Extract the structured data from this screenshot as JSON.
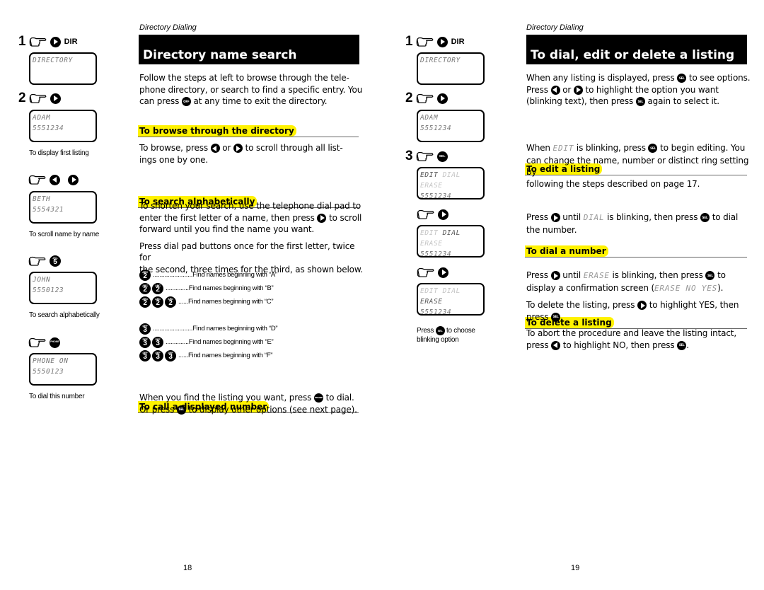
{
  "left_page": {
    "header_label": "Directory Dialing",
    "title": "Directory name search",
    "intro": [
      "Follow the steps at left to browse through the tele-",
      "phone directory, or search to find a specific entry. You",
      "can press",
      "at any time to exit the directory."
    ],
    "off_key_label": "OFF",
    "sections": {
      "browse": {
        "heading": "To browse through the directory",
        "text_before": "To browse, press",
        "or": "or",
        "text_after": "to scroll through all list-",
        "text_line2": "ings one by one."
      },
      "search": {
        "heading": "To search alphabetically",
        "p1_line1": "To shorten your search, use the telephone dial pad to",
        "p1_line2a": "enter the first letter of a name, then press",
        "p1_line2b": "to scroll",
        "p1_line3": "forward until you find the name you want.",
        "p2_line1": "Press dial pad buttons once for the first letter, twice for",
        "p2_line2": "the second, three times for the third, as shown below.",
        "find_rows": [
          {
            "key": "2",
            "key_letters": "ABC",
            "presses": 1,
            "dots": "........................",
            "text": "Find names beginning with “A”"
          },
          {
            "key": "2",
            "key_letters": "ABC",
            "presses": 2,
            "dots": "..............",
            "text": "Find names beginning with “B”"
          },
          {
            "key": "2",
            "key_letters": "ABC",
            "presses": 3,
            "dots": "......",
            "text": "Find names beginning with “C”"
          },
          {
            "key": "3",
            "key_letters": "DEF",
            "presses": 1,
            "dots": "........................",
            "text": "Find names beginning with “D”"
          },
          {
            "key": "3",
            "key_letters": "DEF",
            "presses": 2,
            "dots": "..............",
            "text": "Find names beginning with “E”"
          },
          {
            "key": "3",
            "key_letters": "DEF",
            "presses": 3,
            "dots": "......",
            "text": "Find names beginning with “F”"
          }
        ]
      },
      "call": {
        "heading": "To call a displayed number",
        "line1a": "When you find the listing you want, press",
        "line1b": "to dial.",
        "line2a": "Or press",
        "line2b": "to display other options (see next page).",
        "phone_key_label": "PHONE",
        "sel_key_label": "SEL"
      }
    },
    "steps": [
      {
        "num": "1",
        "button": "right-arrow",
        "button_label": "DIR",
        "lcd": [
          "DIRECTORY",
          ""
        ],
        "caption": ""
      },
      {
        "num": "2",
        "button": "right-arrow",
        "lcd": [
          "ADAM",
          "5551234"
        ],
        "caption": "To display first listing"
      },
      {
        "num": "",
        "button": "left-right-arrows",
        "lcd": [
          "BETH",
          "5554321"
        ],
        "caption": "To scroll name by name"
      },
      {
        "num": "",
        "button": "key-5",
        "key_label": "5",
        "key_letters": "JKL",
        "lcd": [
          "JOHN",
          "5550123"
        ],
        "caption": "To search alphabetically"
      },
      {
        "num": "",
        "button": "phone",
        "key_label": "PHONE",
        "lcd": [
          "PHONE ON",
          "5550123"
        ],
        "caption": "To dial this number"
      }
    ],
    "page_number": "18"
  },
  "right_page": {
    "header_label": "Directory Dialing",
    "title": "To dial, edit or delete a listing",
    "intro_l1a": "When any listing is displayed, press",
    "intro_l1b": "to see options.",
    "intro_l2a": "Press",
    "intro_l2or": "or",
    "intro_l2b": "to highlight the option you want",
    "intro_l3a": "(blinking text), then press",
    "intro_l3b": "again to select it.",
    "sel_key_label": "SEL",
    "sections": {
      "edit": {
        "heading": "To edit a listing",
        "l1a": "When",
        "lcd_word": "EDIT",
        "l1b": "is blinking, press",
        "l1c": "to begin editing. You",
        "l2": "can change the name, number or distinct ring setting by",
        "l3": "following the steps described on page 17."
      },
      "dial": {
        "heading": "To dial a number",
        "l1a": "Press",
        "l1b": "until",
        "lcd_word": "DIAL",
        "l1c": "is blinking, then press",
        "l1d": "to dial",
        "l2": "the number."
      },
      "delete": {
        "heading": "To delete a listing",
        "p1_l1a": "Press",
        "p1_l1b": "until",
        "lcd_word": "ERASE",
        "p1_l1c": "is blinking, then press",
        "p1_l1d": "to",
        "p1_l2a": "display a confirmation screen (",
        "lcd_confirm": "ERASE NO YES",
        "p1_l2b": ").",
        "p2_l1a": "To delete the listing, press",
        "p2_l1b": "to highlight YES, then",
        "p2_l2": "press",
        "p3_l1": "To abort the procedure and leave the listing intact,",
        "p3_l2a": "press",
        "p3_l2b": "to highlight NO, then press"
      }
    },
    "steps": [
      {
        "num": "1",
        "button": "right-arrow",
        "button_label": "DIR",
        "lcd": [
          "DIRECTORY",
          ""
        ]
      },
      {
        "num": "2",
        "button": "right-arrow",
        "lcd": [
          "ADAM",
          "5551234"
        ]
      },
      {
        "num": "3",
        "button": "sel",
        "key_label": "SEL",
        "lcd_options": [
          "EDIT",
          "DIAL",
          "ERASE"
        ],
        "active": "EDIT",
        "lcd_line2": "5551234"
      },
      {
        "num": "",
        "button": "right-arrow",
        "lcd_options": [
          "EDIT",
          "DIAL",
          "ERASE"
        ],
        "active": "DIAL",
        "lcd_line2": "5551234"
      },
      {
        "num": "",
        "button": "right-arrow",
        "lcd_options": [
          "EDIT",
          "DIAL",
          "ERASE"
        ],
        "active": "ERASE",
        "lcd_line2": "5551234"
      }
    ],
    "step_caption_a": "Press",
    "step_caption_b": "to choose",
    "step_caption_c": "blinking option",
    "page_number": "19"
  },
  "colors": {
    "highlight": "#fff200",
    "title_bg": "#000000",
    "lcd_text": "#777777"
  }
}
